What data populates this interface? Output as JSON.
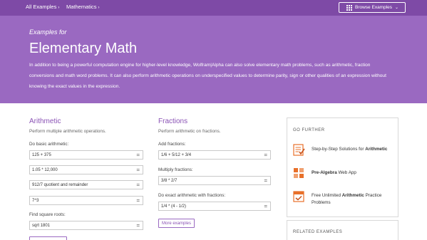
{
  "breadcrumbs": [
    {
      "label": "All Examples",
      "chev": "›"
    },
    {
      "label": "Mathematics",
      "chev": "›"
    }
  ],
  "browse_button": {
    "label": "Browse Examples",
    "icon": "grid-icon",
    "chev": "⌄"
  },
  "hero": {
    "subtitle": "Examples for",
    "title": "Elementary Math",
    "description": "In addition to being a powerful computation engine for higher-level knowledge, Wolfram|Alpha can also solve elementary math problems, such as arithmetic, fraction conversions and math word problems. It can also perform arithmetic operations on underspecified values to determine parity, sign or other qualities of an expression without knowing the exact values in the expression."
  },
  "arithmetic": {
    "title": "Arithmetic",
    "description": "Perform multiple arithmetic operations.",
    "basic_label": "Do basic arithmetic:",
    "basic_inputs": [
      "125 + 375",
      "1.05 * 12,000",
      "912/7 quotient and remainder",
      "7^3"
    ],
    "sqrt_label": "Find square roots:",
    "sqrt_input": "sqrt 1801"
  },
  "fractions": {
    "title": "Fractions",
    "description": "Perform arithmetic on fractions.",
    "add_label": "Add fractions:",
    "add_input": "1/6 + 5/12 + 3/4",
    "multiply_label": "Multiply fractions:",
    "multiply_input": "3/8 * 2/7",
    "exact_label": "Do exact arithmetic with fractions:",
    "exact_input": "1/4 * (4 - 1/2)",
    "more_label": "More examples"
  },
  "go_further": {
    "heading": "GO FURTHER",
    "items": [
      {
        "pre": "Step-by-Step Solutions for ",
        "bold": "Arithmetic",
        "post": "",
        "icon": "step-by-step-icon"
      },
      {
        "pre": "",
        "bold": "Pre-Algebra",
        "post": " Web App",
        "icon": "web-app-icon"
      },
      {
        "pre": "Free Unlimited ",
        "bold": "Arithmetic",
        "post": " Practice Problems",
        "icon": "practice-problems-icon"
      }
    ]
  },
  "related": {
    "heading": "RELATED EXAMPLES"
  },
  "colors": {
    "header": "#7e4aa6",
    "hero": "#9a69c1",
    "accent": "#8a52b5",
    "icon_orange": "#e8702a"
  }
}
